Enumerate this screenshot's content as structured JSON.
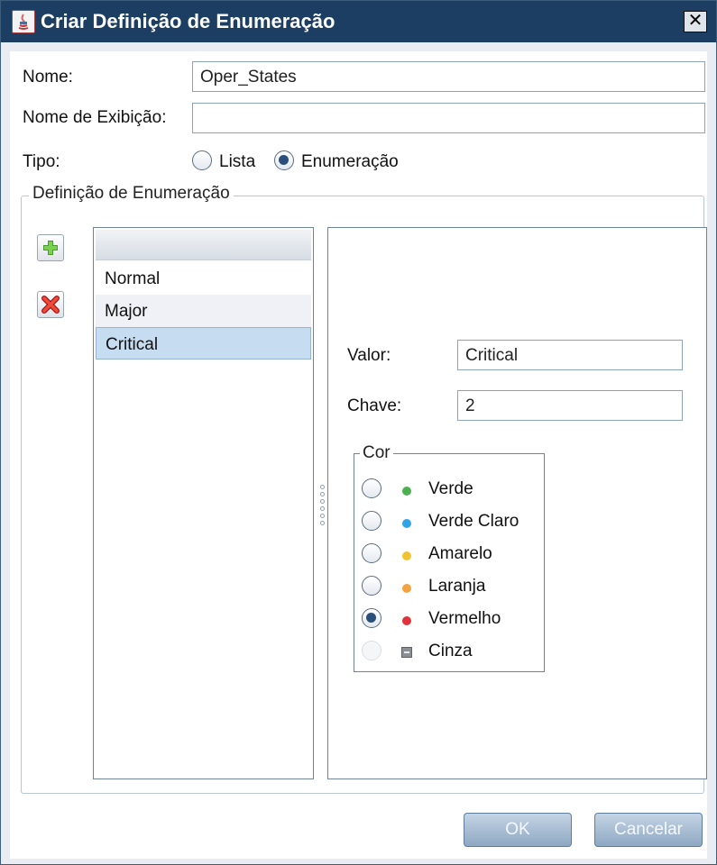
{
  "window": {
    "title": "Criar Definição de Enumeração",
    "close_label": "✕"
  },
  "form": {
    "name_label": "Nome:",
    "name_value": "Oper_States",
    "display_label": "Nome de Exibição:",
    "display_value": "",
    "type_label": "Tipo:",
    "type_options": [
      "Lista",
      "Enumeração"
    ],
    "type_selected": "Enumeração"
  },
  "definition": {
    "group_title": "Definição de Enumeração",
    "add_icon": "plus-icon",
    "delete_icon": "delete-x-icon",
    "items": [
      "Normal",
      "Major",
      "Critical"
    ],
    "selected_item": "Critical",
    "value_label": "Valor:",
    "value": "Critical",
    "key_label": "Chave:",
    "key": "2",
    "color_group_title": "Cor",
    "colors": [
      {
        "label": "Verde",
        "color": "#4caf50"
      },
      {
        "label": "Verde Claro",
        "color": "#2fa3e6"
      },
      {
        "label": "Amarelo",
        "color": "#f1c232"
      },
      {
        "label": "Laranja",
        "color": "#f5a340"
      },
      {
        "label": "Vermelho",
        "color": "#e0333b"
      },
      {
        "label": "Cinza",
        "color": "#8b8f94"
      }
    ],
    "color_selected": "Vermelho"
  },
  "footer": {
    "ok_label": "OK",
    "cancel_label": "Cancelar"
  }
}
